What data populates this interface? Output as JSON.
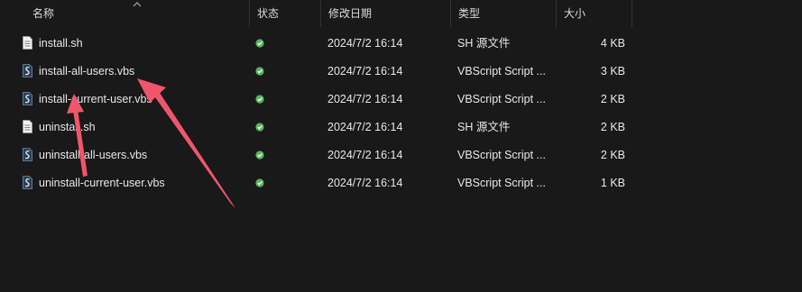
{
  "columns": {
    "name": "名称",
    "status": "状态",
    "modified": "修改日期",
    "type": "类型",
    "size": "大小"
  },
  "files": [
    {
      "name": "install.sh",
      "icon": "sh-file-icon",
      "modified": "2024/7/2 16:14",
      "type": "SH 源文件",
      "size": "4 KB"
    },
    {
      "name": "install-all-users.vbs",
      "icon": "vbs-file-icon",
      "modified": "2024/7/2 16:14",
      "type": "VBScript Script ...",
      "size": "3 KB"
    },
    {
      "name": "install-current-user.vbs",
      "icon": "vbs-file-icon",
      "modified": "2024/7/2 16:14",
      "type": "VBScript Script ...",
      "size": "2 KB"
    },
    {
      "name": "uninstall.sh",
      "icon": "sh-file-icon",
      "modified": "2024/7/2 16:14",
      "type": "SH 源文件",
      "size": "2 KB"
    },
    {
      "name": "uninstall-all-users.vbs",
      "icon": "vbs-file-icon",
      "modified": "2024/7/2 16:14",
      "type": "VBScript Script ...",
      "size": "2 KB"
    },
    {
      "name": "uninstall-current-user.vbs",
      "icon": "vbs-file-icon",
      "modified": "2024/7/2 16:14",
      "type": "VBScript Script ...",
      "size": "1 KB"
    }
  ],
  "colors": {
    "background": "#191919",
    "status_ok": "#5ab55e",
    "annotation_arrow": "#f0566a"
  }
}
